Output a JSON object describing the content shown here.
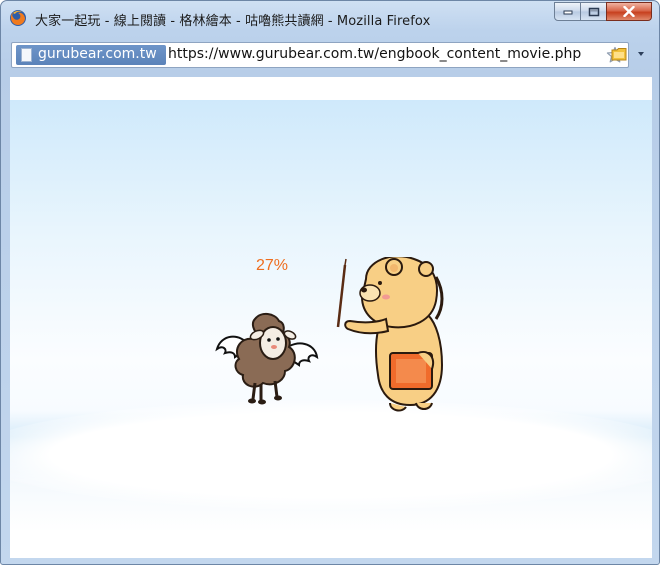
{
  "window": {
    "title": "大家一起玩 - 線上閱讀 - 格林繪本 - 咕嚕熊共讀網 - Mozilla Firefox",
    "app_icon": "firefox-icon",
    "buttons": [
      "minimize-icon",
      "maximize-icon",
      "close-icon"
    ]
  },
  "address_bar": {
    "site_identity": "gurubear.com.tw",
    "url": "https://www.gurubear.com.tw/engbook_content_movie.php",
    "bookmark_icon": "star-icon",
    "extra_icon": "bookmark-folder-icon"
  },
  "content": {
    "loading_percent": "27%",
    "loading_value": 0.27,
    "illustrations": [
      "angel-sheep",
      "teacher-bear-with-pointer"
    ]
  },
  "colors": {
    "percent_text": "#ee6d1f",
    "sky_top": "#cfe9fb",
    "bear_fur": "#f8cf85",
    "sheep_wool": "#8a6b55",
    "book": "#f06b2b"
  }
}
